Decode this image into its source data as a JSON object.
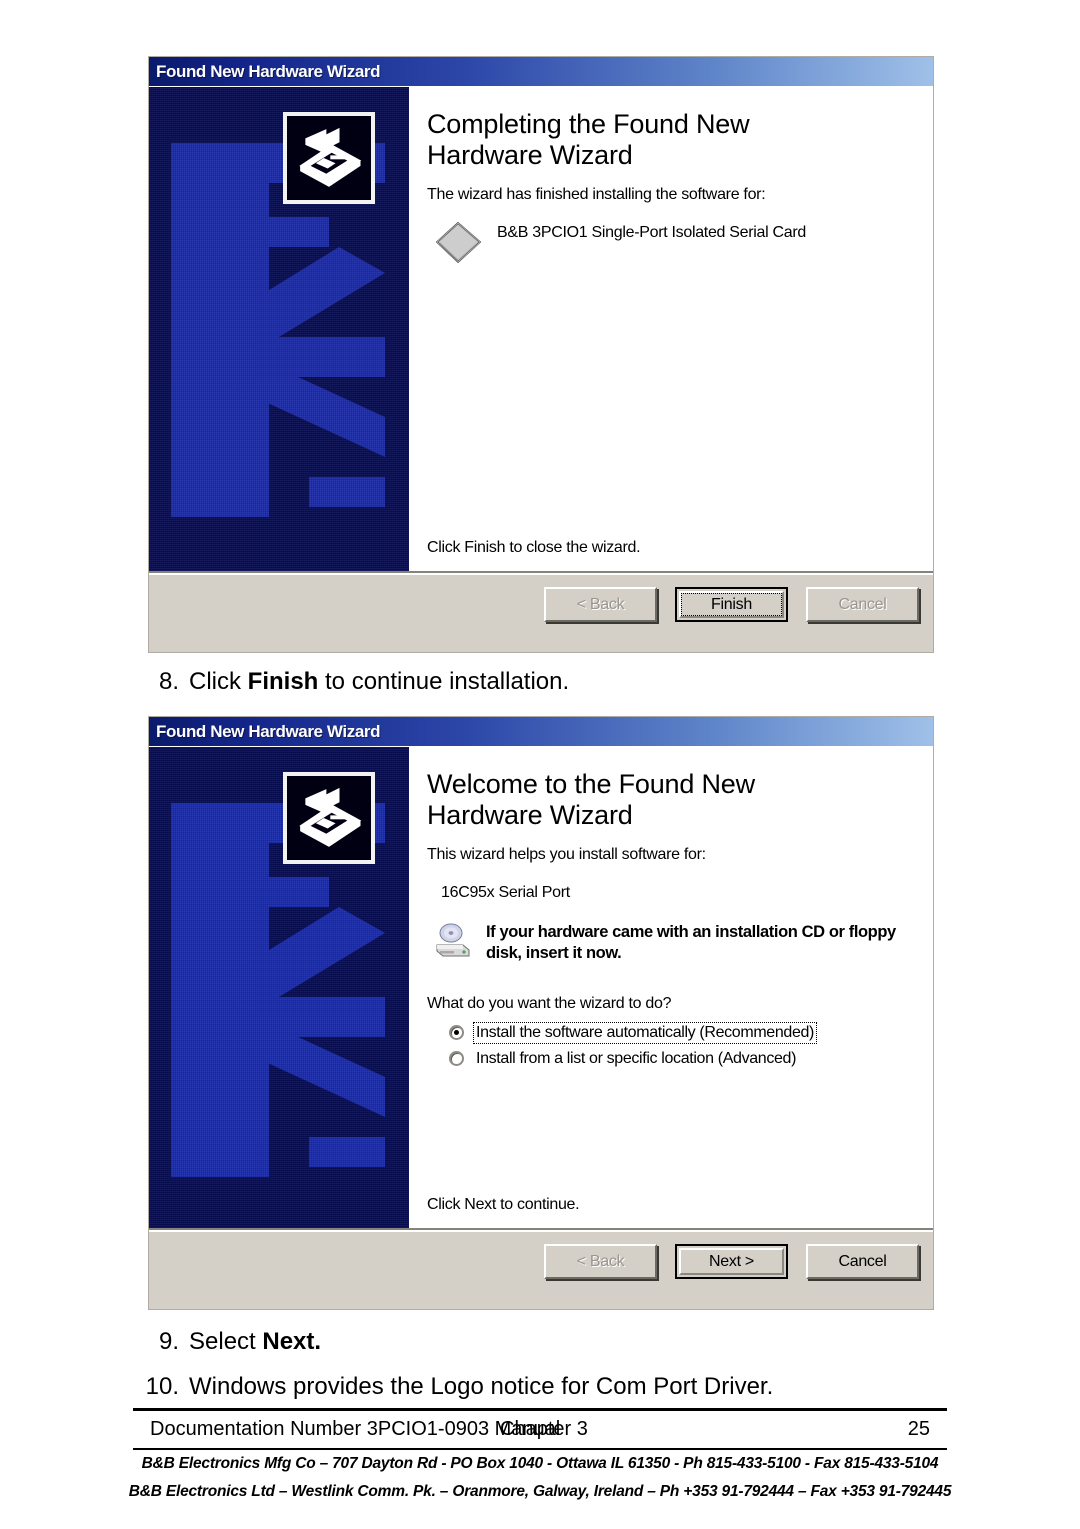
{
  "document": {
    "steps": [
      {
        "number": "8.",
        "pre": "Click ",
        "bold": "Finish",
        "post": " to continue installation."
      },
      {
        "number": "9.",
        "pre": "Select ",
        "bold": "Next.",
        "post": ""
      },
      {
        "number": "10.",
        "pre": "Windows provides the Logo notice for Com Port Driver.",
        "bold": "",
        "post": ""
      }
    ],
    "footer": {
      "doc_number": "Documentation Number 3PCIO1-0903 Manual",
      "chapter": "Chapter 3",
      "page": "25",
      "address_line_1": "B&B Electronics Mfg Co – 707 Dayton Rd - PO Box 1040 - Ottawa IL 61350 - Ph 815-433-5100 - Fax 815-433-5104",
      "address_line_2": "B&B Electronics Ltd – Westlink Comm. Pk. – Oranmore, Galway, Ireland – Ph +353 91-792444 – Fax +353 91-792445"
    }
  },
  "dialog_finish": {
    "titlebar": "Found New Hardware Wizard",
    "heading": "Completing the Found New Hardware Wizard",
    "body_text": "The wizard has finished installing the software for:",
    "device_name": "B&B 3PCIO1 Single-Port Isolated Serial Card",
    "device_icon": "card-diamond-icon",
    "banner_icon": "found-new-hardware-icon",
    "bottom_text": "Click Finish to close the wizard.",
    "buttons": [
      {
        "label": "< Back",
        "underline_char": "B",
        "state": "disabled",
        "name": "back-button"
      },
      {
        "label": "Finish",
        "underline_char": "",
        "state": "default-focused",
        "name": "finish-button"
      },
      {
        "label": "Cancel",
        "underline_char": "",
        "state": "disabled",
        "name": "cancel-button"
      }
    ]
  },
  "dialog_welcome": {
    "titlebar": "Found New Hardware Wizard",
    "heading": "Welcome to the Found New Hardware Wizard",
    "body_text": "This wizard helps you install software for:",
    "device_name": "16C95x Serial Port",
    "banner_icon": "found-new-hardware-icon",
    "cd_icon": "cd-drive-icon",
    "cd_note": "If your hardware came with an installation CD or floppy disk, insert it now.",
    "question": "What do you want the wizard to do?",
    "options": [
      {
        "label": "Install the software automatically (Recommended)",
        "checked": true,
        "focused": true
      },
      {
        "label": "Install from a list or specific location (Advanced)",
        "checked": false,
        "focused": false
      }
    ],
    "bottom_text": "Click Next to continue.",
    "buttons": [
      {
        "label": "< Back",
        "underline_char": "B",
        "state": "disabled",
        "name": "back-button"
      },
      {
        "label": "Next >",
        "underline_char": "N",
        "state": "default",
        "name": "next-button"
      },
      {
        "label": "Cancel",
        "underline_char": "",
        "state": "normal",
        "name": "cancel-button"
      }
    ]
  },
  "colors": {
    "title_start": "#0a1a6b",
    "title_end": "#9fc0e8",
    "banner_bg": "#0a0f52",
    "banner_art": "#1f2fa8",
    "dialog_face": "#d4d0c8"
  }
}
